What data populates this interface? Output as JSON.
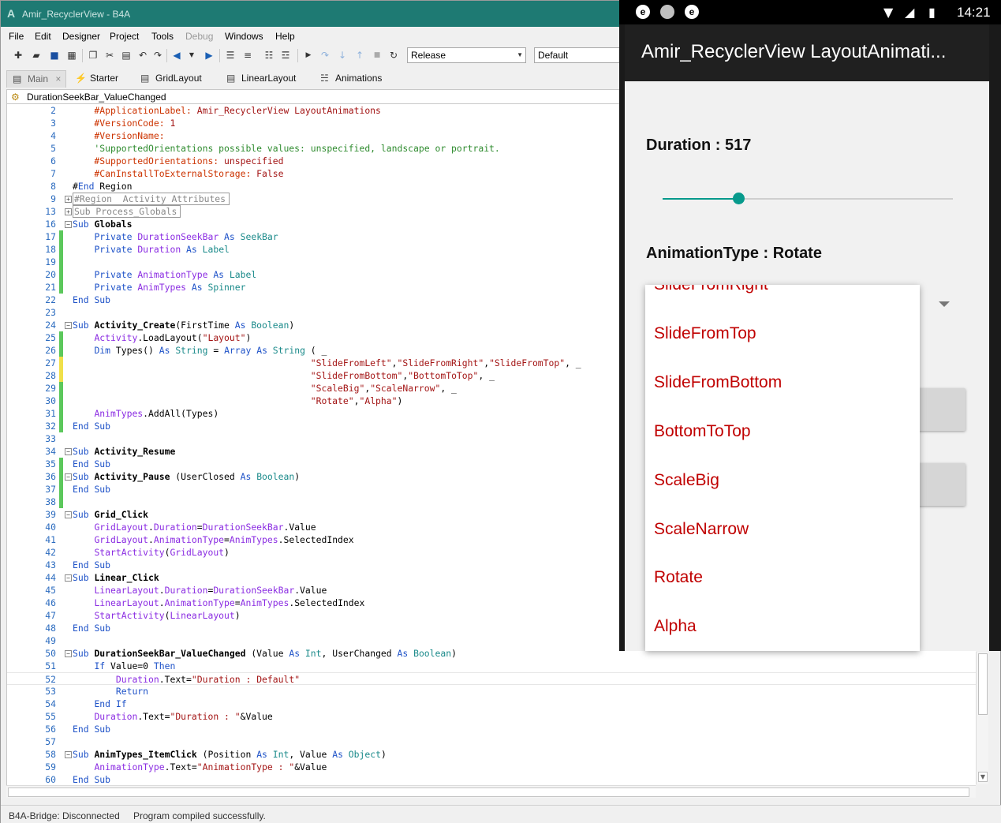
{
  "ide": {
    "window_title": "Amir_RecyclerView - B4A",
    "menu": [
      "File",
      "Edit",
      "Designer",
      "Project",
      "Tools",
      "Debug",
      "Windows",
      "Help"
    ],
    "build_config": "Release",
    "device_config": "Default",
    "tabs": [
      {
        "label": "Main",
        "close": "×"
      },
      {
        "label": "Starter"
      },
      {
        "label": "GridLayout"
      },
      {
        "label": "LinearLayout"
      },
      {
        "label": "Animations"
      }
    ],
    "current_sub": "DurationSeekBar_ValueChanged",
    "status": {
      "bridge": "B4A-Bridge: Disconnected",
      "message": "Program compiled successfully."
    }
  },
  "code_lines": [
    {
      "n": "2",
      "t": "    #ApplicationLabel: Amir_RecyclerView LayoutAnimations"
    },
    {
      "n": "3",
      "t": "    #VersionCode: 1"
    },
    {
      "n": "4",
      "t": "    #VersionName:"
    },
    {
      "n": "5",
      "t": "    'SupportedOrientations possible values: unspecified, landscape or portrait."
    },
    {
      "n": "6",
      "t": "    #SupportedOrientations: unspecified"
    },
    {
      "n": "7",
      "t": "    #CanInstallToExternalStorage: False"
    },
    {
      "n": "8",
      "t": "#End Region"
    },
    {
      "n": "9",
      "t": "#Region  Activity Attributes"
    },
    {
      "n": "13",
      "t": "Sub Process_Globals"
    },
    {
      "n": "16",
      "t": "Sub Globals"
    },
    {
      "n": "17",
      "t": "    Private DurationSeekBar As SeekBar"
    },
    {
      "n": "18",
      "t": "    Private Duration As Label"
    },
    {
      "n": "19",
      "t": ""
    },
    {
      "n": "20",
      "t": "    Private AnimationType As Label"
    },
    {
      "n": "21",
      "t": "    Private AnimTypes As Spinner"
    },
    {
      "n": "22",
      "t": "End Sub"
    },
    {
      "n": "23",
      "t": ""
    },
    {
      "n": "24",
      "t": "Sub Activity_Create(FirstTime As Boolean)"
    },
    {
      "n": "25",
      "t": "    Activity.LoadLayout(\"Layout\")"
    },
    {
      "n": "26",
      "t": "    Dim Types() As String = Array As String ( _"
    },
    {
      "n": "27",
      "t": "                                            \"SlideFromLeft\",\"SlideFromRight\",\"SlideFromTop\", _"
    },
    {
      "n": "28",
      "t": "                                            \"SlideFromBottom\",\"BottomToTop\", _"
    },
    {
      "n": "29",
      "t": "                                            \"ScaleBig\",\"ScaleNarrow\", _"
    },
    {
      "n": "30",
      "t": "                                            \"Rotate\",\"Alpha\")"
    },
    {
      "n": "31",
      "t": "    AnimTypes.AddAll(Types)"
    },
    {
      "n": "32",
      "t": "End Sub"
    },
    {
      "n": "33",
      "t": ""
    },
    {
      "n": "34",
      "t": "Sub Activity_Resume"
    },
    {
      "n": "35",
      "t": "End Sub"
    },
    {
      "n": "36",
      "t": "Sub Activity_Pause (UserClosed As Boolean)"
    },
    {
      "n": "37",
      "t": "End Sub"
    },
    {
      "n": "38",
      "t": ""
    },
    {
      "n": "39",
      "t": "Sub Grid_Click"
    },
    {
      "n": "40",
      "t": "    GridLayout.Duration=DurationSeekBar.Value"
    },
    {
      "n": "41",
      "t": "    GridLayout.AnimationType=AnimTypes.SelectedIndex"
    },
    {
      "n": "42",
      "t": "    StartActivity(GridLayout)"
    },
    {
      "n": "43",
      "t": "End Sub"
    },
    {
      "n": "44",
      "t": "Sub Linear_Click"
    },
    {
      "n": "45",
      "t": "    LinearLayout.Duration=DurationSeekBar.Value"
    },
    {
      "n": "46",
      "t": "    LinearLayout.AnimationType=AnimTypes.SelectedIndex"
    },
    {
      "n": "47",
      "t": "    StartActivity(LinearLayout)"
    },
    {
      "n": "48",
      "t": "End Sub"
    },
    {
      "n": "49",
      "t": ""
    },
    {
      "n": "50",
      "t": "Sub DurationSeekBar_ValueChanged (Value As Int, UserChanged As Boolean)"
    },
    {
      "n": "51",
      "t": "    If Value=0 Then"
    },
    {
      "n": "52",
      "t": "        Duration.Text=\"Duration : Default\""
    },
    {
      "n": "53",
      "t": "        Return"
    },
    {
      "n": "54",
      "t": "    End If"
    },
    {
      "n": "55",
      "t": "    Duration.Text=\"Duration : \"&Value"
    },
    {
      "n": "56",
      "t": "End Sub"
    },
    {
      "n": "57",
      "t": ""
    },
    {
      "n": "58",
      "t": "Sub AnimTypes_ItemClick (Position As Int, Value As Object)"
    },
    {
      "n": "59",
      "t": "    AnimationType.Text=\"AnimationType : \"&Value"
    },
    {
      "n": "60",
      "t": "End Sub"
    }
  ],
  "device": {
    "clock": "14:21",
    "app_title": "Amir_RecyclerView LayoutAnimati...",
    "duration_label": "Duration : 517",
    "seekbar_fraction": 0.26,
    "animation_type_label": "AnimationType : Rotate",
    "dropdown_items": [
      "SlideFromRight",
      "SlideFromTop",
      "SlideFromBottom",
      "BottomToTop",
      "ScaleBig",
      "ScaleNarrow",
      "Rotate",
      "Alpha"
    ],
    "accent": "#079a8c",
    "item_color": "#c00000"
  }
}
